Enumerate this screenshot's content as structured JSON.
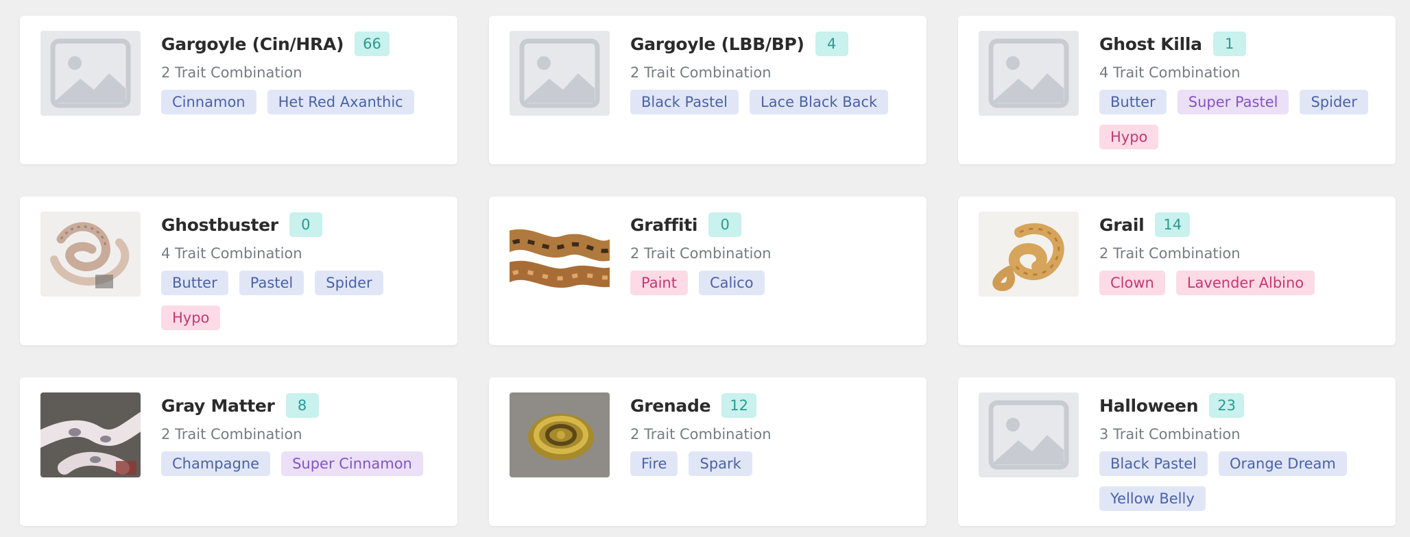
{
  "colors": {
    "background": "#efefef",
    "card": "#ffffff",
    "count_badge_bg": "#c9f1ee",
    "count_badge_text": "#2a9a92",
    "tag_blue_bg": "#e1e6f7",
    "tag_pink_bg": "#fcdbe6",
    "tag_purple_bg": "#ebe0f7"
  },
  "cards": [
    {
      "name": "Gargoyle (Cin/HRA)",
      "count": "66",
      "combo": "2 Trait Combination",
      "image": "placeholder-image-icon",
      "tags": [
        {
          "label": "Cinnamon",
          "color": "blue"
        },
        {
          "label": "Het Red Axanthic",
          "color": "blue"
        }
      ]
    },
    {
      "name": "Gargoyle (LBB/BP)",
      "count": "4",
      "combo": "2 Trait Combination",
      "image": "placeholder-image-icon",
      "tags": [
        {
          "label": "Black Pastel",
          "color": "blue"
        },
        {
          "label": "Lace Black Back",
          "color": "blue"
        }
      ]
    },
    {
      "name": "Ghost Killa",
      "count": "1",
      "combo": "4 Trait Combination",
      "image": "placeholder-image-icon",
      "tags": [
        {
          "label": "Butter",
          "color": "blue"
        },
        {
          "label": "Super Pastel",
          "color": "purple"
        },
        {
          "label": "Spider",
          "color": "blue"
        },
        {
          "label": "Hypo",
          "color": "pink"
        }
      ]
    },
    {
      "name": "Ghostbuster",
      "count": "0",
      "combo": "4 Trait Combination",
      "image": "snake-photo-ghostbuster",
      "tags": [
        {
          "label": "Butter",
          "color": "blue"
        },
        {
          "label": "Pastel",
          "color": "blue"
        },
        {
          "label": "Spider",
          "color": "blue"
        },
        {
          "label": "Hypo",
          "color": "pink"
        }
      ]
    },
    {
      "name": "Graffiti",
      "count": "0",
      "combo": "2 Trait Combination",
      "image": "snake-photo-graffiti",
      "tags": [
        {
          "label": "Paint",
          "color": "pink"
        },
        {
          "label": "Calico",
          "color": "blue"
        }
      ]
    },
    {
      "name": "Grail",
      "count": "14",
      "combo": "2 Trait Combination",
      "image": "snake-photo-grail",
      "tags": [
        {
          "label": "Clown",
          "color": "pink"
        },
        {
          "label": "Lavender Albino",
          "color": "pink"
        }
      ]
    },
    {
      "name": "Gray Matter",
      "count": "8",
      "combo": "2 Trait Combination",
      "image": "snake-photo-gray-matter",
      "tags": [
        {
          "label": "Champagne",
          "color": "blue"
        },
        {
          "label": "Super Cinnamon",
          "color": "purple"
        }
      ]
    },
    {
      "name": "Grenade",
      "count": "12",
      "combo": "2 Trait Combination",
      "image": "snake-photo-grenade",
      "tags": [
        {
          "label": "Fire",
          "color": "blue"
        },
        {
          "label": "Spark",
          "color": "blue"
        }
      ]
    },
    {
      "name": "Halloween",
      "count": "23",
      "combo": "3 Trait Combination",
      "image": "placeholder-image-icon",
      "tags": [
        {
          "label": "Black Pastel",
          "color": "blue"
        },
        {
          "label": "Orange Dream",
          "color": "blue"
        },
        {
          "label": "Yellow Belly",
          "color": "blue"
        }
      ]
    }
  ]
}
